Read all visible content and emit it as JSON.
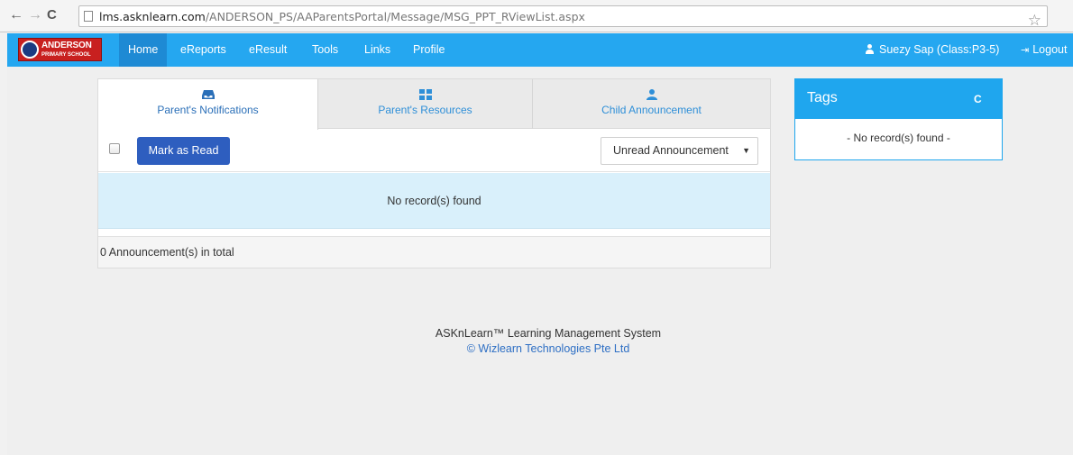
{
  "browser": {
    "url_domain": "lms.asknlearn.com",
    "url_path": "/ANDERSON_PS/AAParentsPortal/Message/MSG_PPT_RViewList.aspx"
  },
  "logo": {
    "line1": "ANDERSON",
    "line2": "PRIMARY SCHOOL"
  },
  "navbar": {
    "items": [
      {
        "label": "Home",
        "active": true
      },
      {
        "label": "eReports"
      },
      {
        "label": "eResult"
      },
      {
        "label": "Tools"
      },
      {
        "label": "Links"
      },
      {
        "label": "Profile"
      }
    ],
    "user_label": "Suezy Sap (Class:P3-5)",
    "logout_label": "Logout"
  },
  "tabs": [
    {
      "label": "Parent's Notifications",
      "icon": "inbox-icon",
      "active": true
    },
    {
      "label": "Parent's Resources",
      "icon": "grid-icon"
    },
    {
      "label": "Child Announcement",
      "icon": "user-icon"
    }
  ],
  "toolbar": {
    "mark_read_label": "Mark as Read",
    "filter_selected": "Unread Announcement"
  },
  "list": {
    "empty_message": "No record(s) found",
    "total_text": "0 Announcement(s) in total"
  },
  "tags": {
    "title": "Tags",
    "empty_message": "- No record(s) found -"
  },
  "footer": {
    "line1": "ASKnLearn™ Learning Management System",
    "line2": "© Wizlearn Technologies Pte Ltd"
  },
  "colors": {
    "navbar": "#25a7f0",
    "primary_button": "#2e5ebf",
    "empty_row": "#d9f0fb"
  }
}
